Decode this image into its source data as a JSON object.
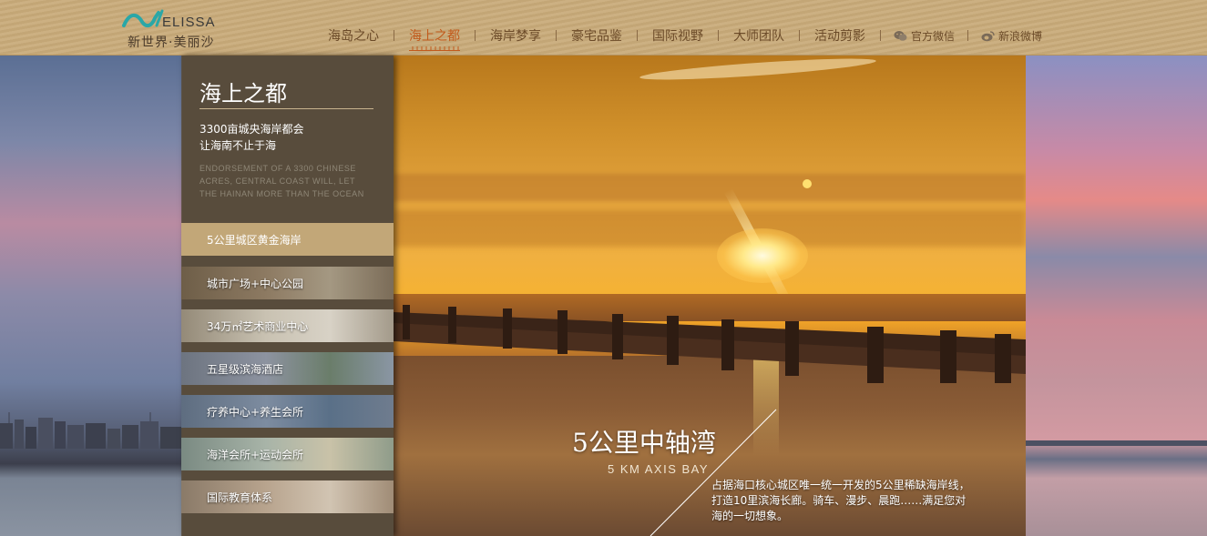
{
  "brand": {
    "logo_text": "ELISSA",
    "logo_cn": "新世界·美丽沙"
  },
  "nav": {
    "items": [
      {
        "label": "海岛之心",
        "active": false
      },
      {
        "label": "海上之都",
        "active": true
      },
      {
        "label": "海岸梦享",
        "active": false
      },
      {
        "label": "豪宅品鉴",
        "active": false
      },
      {
        "label": "国际视野",
        "active": false
      },
      {
        "label": "大师团队",
        "active": false
      },
      {
        "label": "活动剪影",
        "active": false
      }
    ],
    "wechat_label": "官方微信",
    "weibo_label": "新浪微博",
    "wechat_icon": "wechat-icon",
    "weibo_icon": "weibo-icon",
    "accent_color": "#c25a1c"
  },
  "sidebar": {
    "title": "海上之都",
    "subtitle_1": "3300亩城央海岸都会",
    "subtitle_2": "让海南不止于海",
    "english_lines": [
      "ENDORSEMENT OF A 3300 CHINESE",
      "ACRES, CENTRAL COAST WILL, LET",
      "THE HAINAN MORE THAN THE OCEAN"
    ],
    "menu": [
      {
        "label": "5公里城区黄金海岸",
        "active": true
      },
      {
        "label": "城市广场+中心公园",
        "active": false
      },
      {
        "label": "34万㎡艺术商业中心",
        "active": false
      },
      {
        "label": "五星级滨海酒店",
        "active": false
      },
      {
        "label": "疗养中心+养生会所",
        "active": false
      },
      {
        "label": "海洋会所+运动会所",
        "active": false
      },
      {
        "label": "国际教育体系",
        "active": false
      }
    ]
  },
  "caption": {
    "title": "5公里中轴湾",
    "english": "5 KM AXIS BAY",
    "desc_lines": [
      "占据海口核心城区唯一统一开发的5公里稀缺海岸线，",
      "打造10里滨海长廊。骑车、漫步、晨跑……满足您对",
      "海的一切想象。"
    ]
  }
}
